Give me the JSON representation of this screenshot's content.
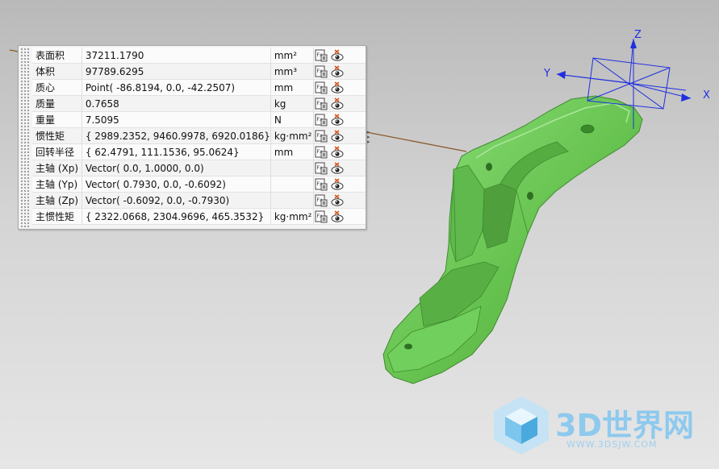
{
  "properties": [
    {
      "name": "表面积",
      "value": "37211.1790",
      "unit": "mm²"
    },
    {
      "name": "体积",
      "value": "97789.6295",
      "unit": "mm³"
    },
    {
      "name": "质心",
      "value": "Point( -86.8194, 0.0, -42.2507)",
      "unit": "mm"
    },
    {
      "name": "质量",
      "value": "0.7658",
      "unit": "kg"
    },
    {
      "name": "重量",
      "value": "7.5095",
      "unit": "N"
    },
    {
      "name": "惯性矩",
      "value": "{ 2989.2352, 9460.9978, 6920.0186}",
      "unit": "kg·mm²"
    },
    {
      "name": "回转半径",
      "value": "{ 62.4791, 111.1536, 95.0624}",
      "unit": "mm"
    },
    {
      "name": "主轴 (Xp)",
      "value": "Vector( 0.0, 1.0000, 0.0)",
      "unit": ""
    },
    {
      "name": "主轴 (Yp)",
      "value": "Vector( 0.7930, 0.0, -0.6092)",
      "unit": ""
    },
    {
      "name": "主轴 (Zp)",
      "value": "Vector( -0.6092, 0.0, -0.7930)",
      "unit": ""
    },
    {
      "name": "主惯性矩",
      "value": "{ 2322.0668, 2304.9696, 465.3532}",
      "unit": "kg·mm²"
    }
  ],
  "axes": {
    "x": "X",
    "y": "Y",
    "z": "Z"
  },
  "row_icons": {
    "first": "parameter-export-icon",
    "second": "show-measure-icon"
  },
  "colors": {
    "part": "#6dc85a",
    "axes": "#1f2fe0",
    "leader": "#8b5a2b",
    "watermark": "#8ec9ee"
  },
  "watermark": {
    "brand": "3D世界网",
    "url": "WWW.3DSJW.COM"
  }
}
